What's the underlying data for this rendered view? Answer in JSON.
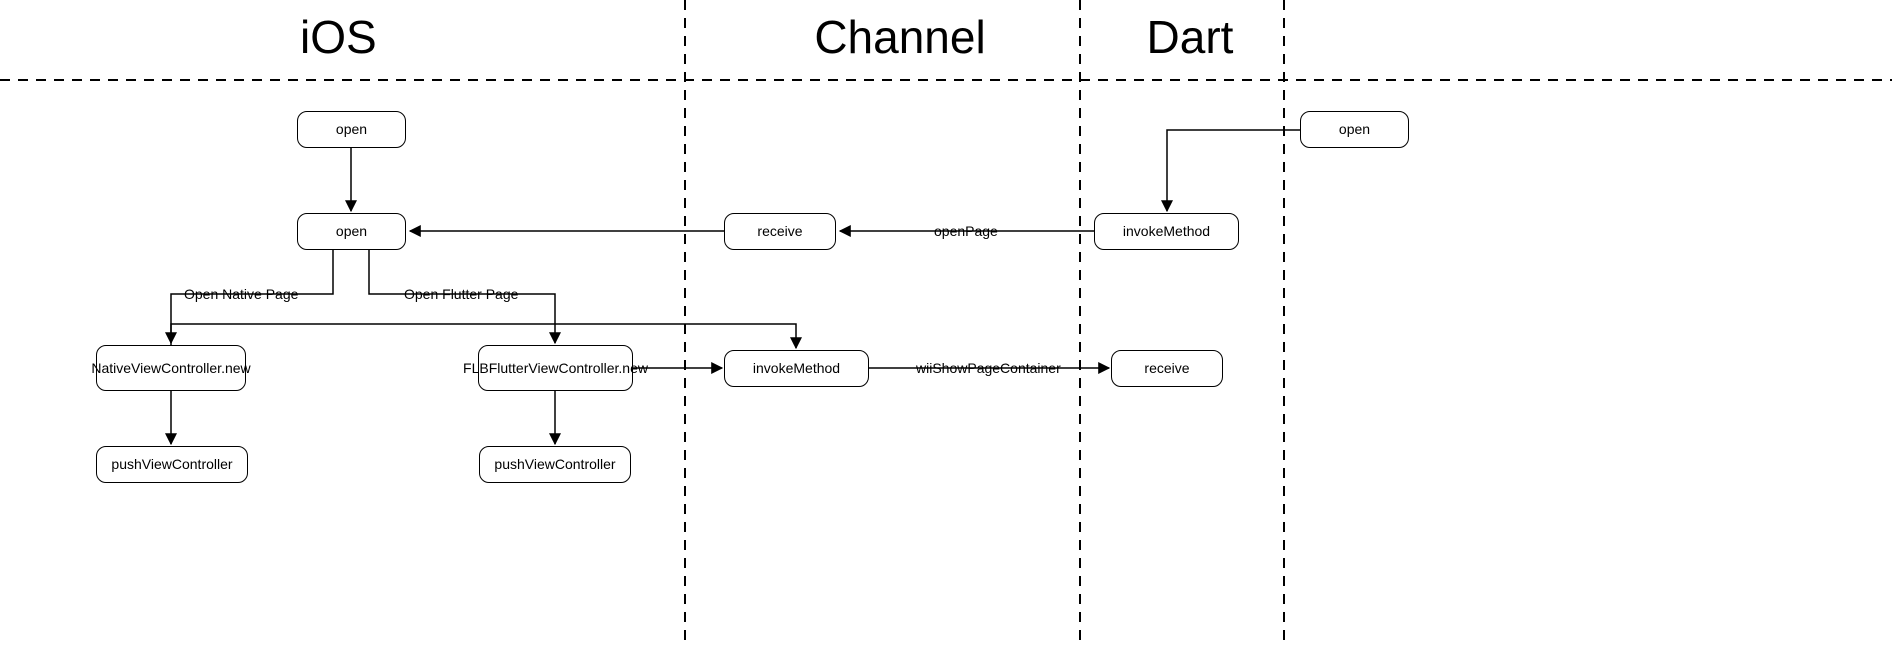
{
  "sections": {
    "ios": "iOS",
    "channel": "Channel",
    "dart": "Dart"
  },
  "nodes": {
    "ios_open_top": "open",
    "ios_open_mid": "open",
    "native_vc_new": "NativeViewController.new",
    "flb_vc_new": "FLBFlutterViewController.new",
    "push_vc_left": "pushViewController",
    "push_vc_right": "pushViewController",
    "ch_receive": "receive",
    "ch_invoke": "invokeMethod",
    "dart_invoke": "invokeMethod",
    "dart_receive": "receive",
    "dart_open": "open"
  },
  "edges": {
    "open_native": "Open Native Page",
    "open_flutter": "Open Flutter Page",
    "open_page": "openPage",
    "wii_show": "wiiShowPageContainer"
  }
}
